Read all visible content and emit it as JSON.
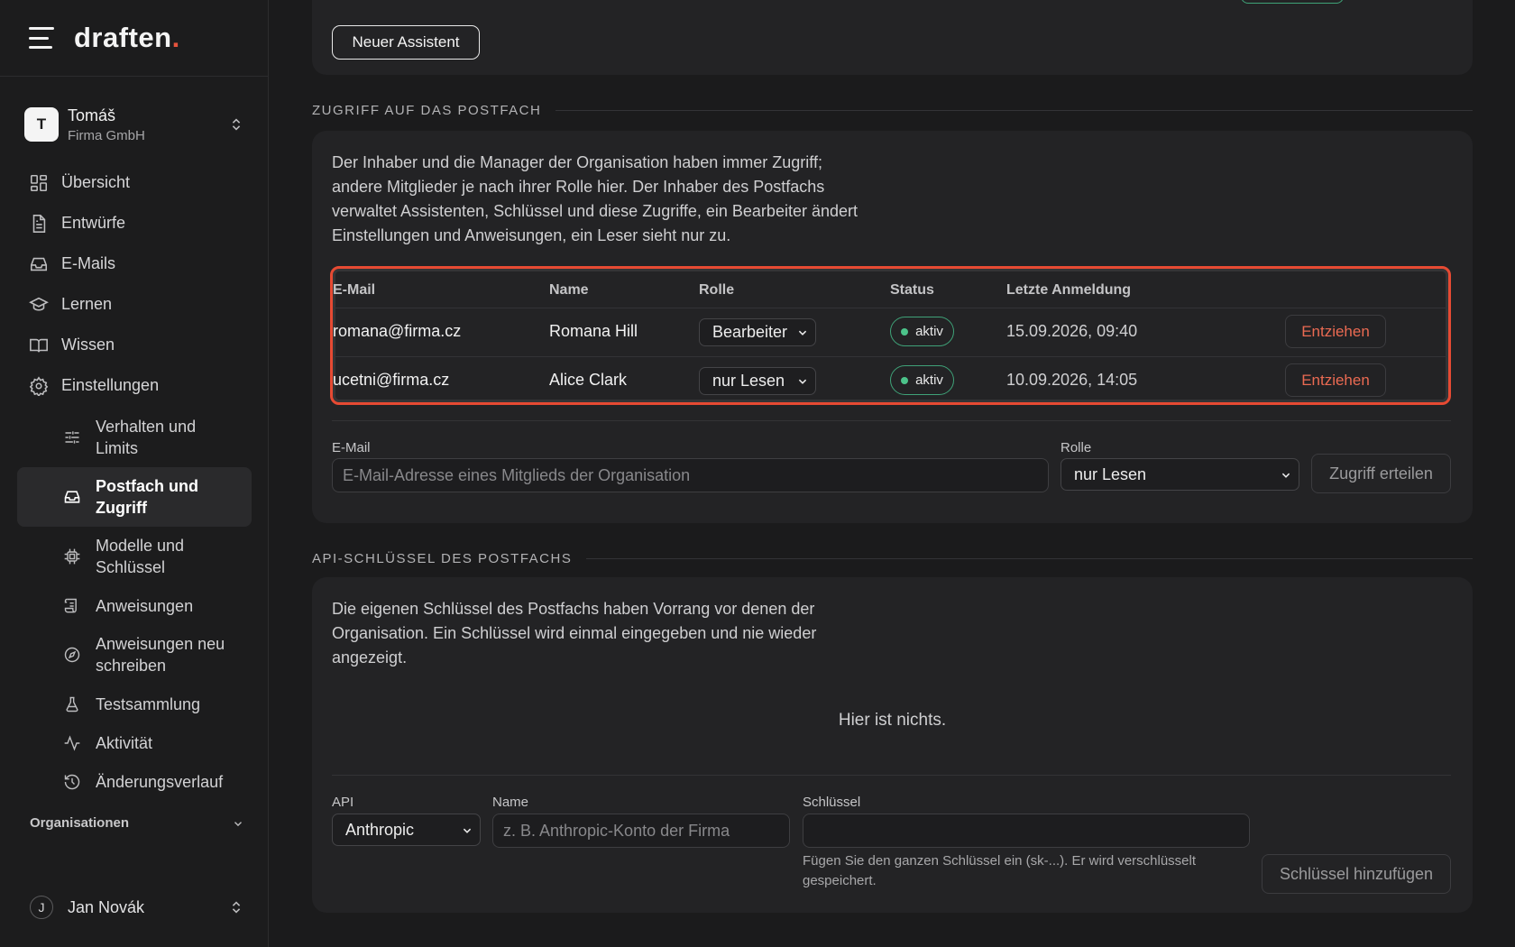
{
  "brand": {
    "logo_text": "draften",
    "logo_dot": "."
  },
  "org_switcher": {
    "initial": "T",
    "name": "Tomáš",
    "company": "Firma GmbH"
  },
  "nav": {
    "items": [
      {
        "label": "Übersicht",
        "icon": "grid-icon"
      },
      {
        "label": "Entwürfe",
        "icon": "document-icon"
      },
      {
        "label": "E-Mails",
        "icon": "inbox-icon"
      },
      {
        "label": "Lernen",
        "icon": "graduation-cap-icon"
      },
      {
        "label": "Wissen",
        "icon": "book-icon"
      },
      {
        "label": "Einstellungen",
        "icon": "gear-icon"
      }
    ],
    "sub_items": [
      {
        "label": "Verhalten und Limits",
        "icon": "sliders-icon"
      },
      {
        "label": "Postfach und Zugriff",
        "icon": "inbox-icon",
        "active": true
      },
      {
        "label": "Modelle und Schlüssel",
        "icon": "chip-icon"
      },
      {
        "label": "Anweisungen",
        "icon": "scroll-icon"
      },
      {
        "label": "Anweisungen neu schreiben",
        "icon": "compass-icon"
      },
      {
        "label": "Testsammlung",
        "icon": "flask-icon"
      },
      {
        "label": "Aktivität",
        "icon": "activity-icon"
      },
      {
        "label": "Änderungsverlauf",
        "icon": "history-icon"
      }
    ]
  },
  "organisations": {
    "label": "Organisationen"
  },
  "user": {
    "initial": "J",
    "name": "Jan Novák"
  },
  "top_card": {
    "new_assistant_label": "Neuer Assistent"
  },
  "access": {
    "section_title": "ZUGRIFF AUF DAS POSTFACH",
    "description": "Der Inhaber und die Manager der Organisation haben immer Zugriff; andere Mitglieder je nach ihrer Rolle hier. Der Inhaber des Postfachs verwaltet Assistenten, Schlüssel und diese Zugriffe, ein Bearbeiter ändert Einstellungen und Anweisungen, ein Leser sieht nur zu.",
    "columns": {
      "email": "E-Mail",
      "name": "Name",
      "role": "Rolle",
      "status": "Status",
      "last_login": "Letzte Anmeldung"
    },
    "rows": [
      {
        "email": "romana@firma.cz",
        "name": "Romana Hill",
        "role": "Bearbeiter",
        "status": "aktiv",
        "last_login": "15.09.2026, 09:40",
        "action": "Entziehen"
      },
      {
        "email": "ucetni@firma.cz",
        "name": "Alice Clark",
        "role": "nur Lesen",
        "status": "aktiv",
        "last_login": "10.09.2026, 14:05",
        "action": "Entziehen"
      }
    ],
    "form": {
      "email_label": "E-Mail",
      "email_placeholder": "E-Mail-Adresse eines Mitglieds der Organisation",
      "role_label": "Rolle",
      "role_value": "nur Lesen",
      "submit_label": "Zugriff erteilen"
    }
  },
  "api_keys": {
    "section_title": "API-SCHLÜSSEL DES POSTFACHS",
    "description": "Die eigenen Schlüssel des Postfachs haben Vorrang vor denen der Organisation. Ein Schlüssel wird einmal eingegeben und nie wieder angezeigt.",
    "empty_text": "Hier ist nichts.",
    "form": {
      "api_label": "API",
      "api_value": "Anthropic",
      "name_label": "Name",
      "name_placeholder": "z. B. Anthropic-Konto der Firma",
      "key_label": "Schlüssel",
      "key_hint": "Fügen Sie den ganzen Schlüssel ein (sk-...). Er wird verschlüsselt gespeichert.",
      "submit_label": "Schlüssel hinzufügen"
    }
  },
  "colors": {
    "accent_red": "#e5533d",
    "status_green": "#4cc38a",
    "danger_text": "#ea6a52"
  }
}
